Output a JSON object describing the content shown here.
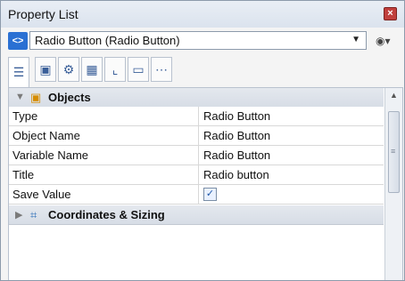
{
  "panel": {
    "title": "Property List"
  },
  "selector": {
    "value": "Radio Button (Radio Button)"
  },
  "tabs": [
    {
      "icon": "list-icon",
      "glyph": "☰"
    },
    {
      "icon": "object-icon",
      "glyph": "▣"
    },
    {
      "icon": "gear-icon",
      "glyph": "⚙"
    },
    {
      "icon": "layout-icon",
      "glyph": "▦"
    },
    {
      "icon": "chart-icon",
      "glyph": "⌞"
    },
    {
      "icon": "monitor-icon",
      "glyph": "▭"
    },
    {
      "icon": "more-icon",
      "glyph": "⋯"
    }
  ],
  "sections": {
    "objects": "Objects",
    "coordinates": "Coordinates & Sizing"
  },
  "properties": [
    {
      "name": "Type",
      "value": "Radio Button"
    },
    {
      "name": "Object Name",
      "value": "Radio Button"
    },
    {
      "name": "Variable Name",
      "value": "Radio Button"
    },
    {
      "name": "Title",
      "value": "Radio button"
    },
    {
      "name": "Save Value",
      "checked": true
    }
  ],
  "icons": {
    "close": "close-icon",
    "eye": "eye-icon",
    "select_caret": "chevron-down-icon"
  }
}
